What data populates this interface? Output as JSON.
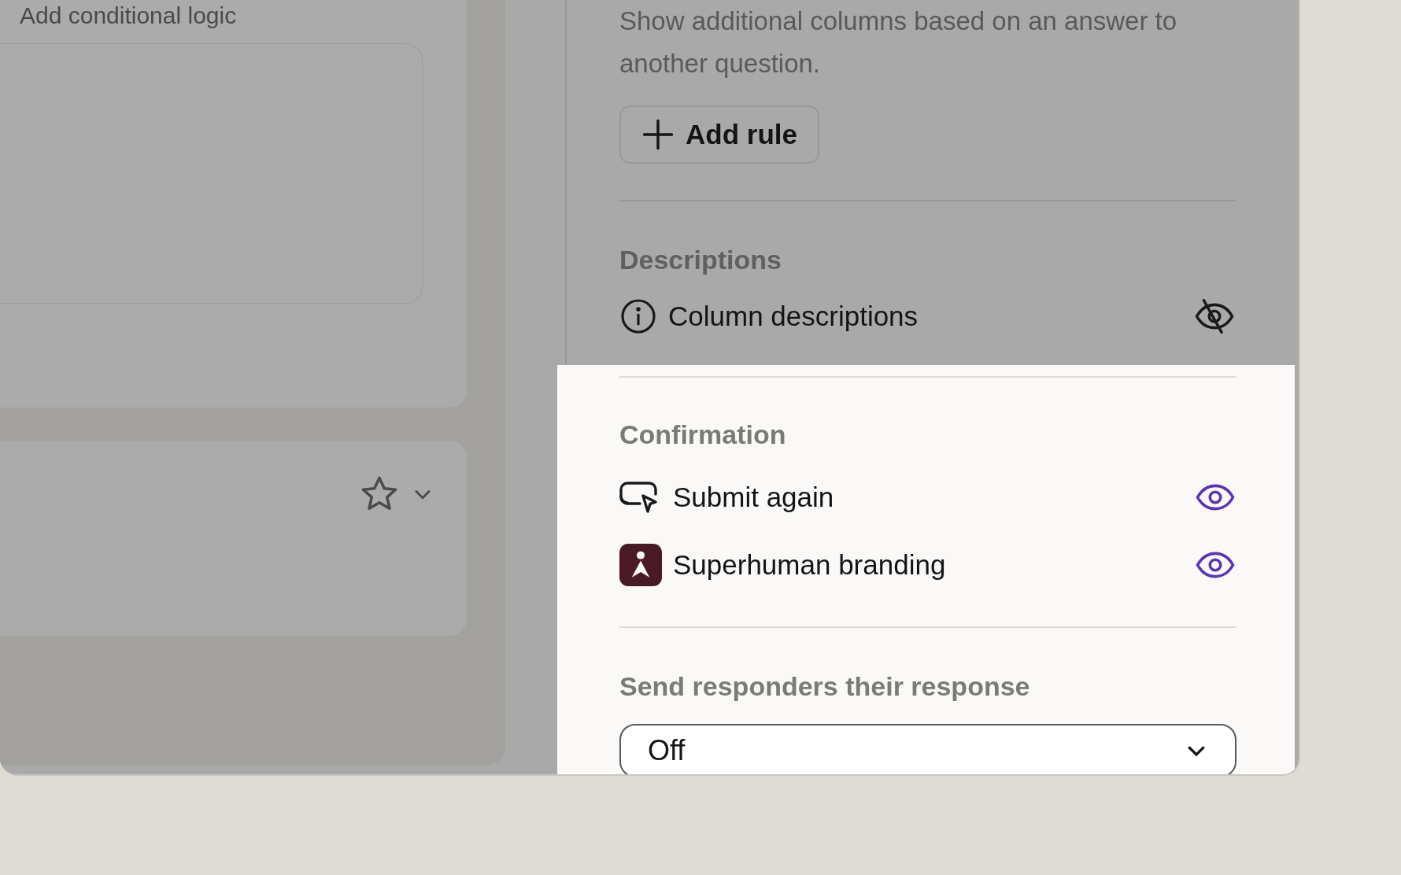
{
  "left_panel": {
    "heading": "Add conditional logic"
  },
  "description": "Show additional columns based on an answer to another question.",
  "add_rule_button": {
    "label": "Add rule"
  },
  "sections": [
    {
      "title": "Descriptions",
      "highlighted": false,
      "items": [
        {
          "kind": "info",
          "label": "Column descriptions",
          "visible": false
        }
      ]
    },
    {
      "title": "Confirmation",
      "highlighted": true,
      "items": [
        {
          "kind": "submit",
          "label": "Submit again",
          "visible": true
        },
        {
          "kind": "brand",
          "label": "Superhuman branding",
          "visible": true
        }
      ]
    }
  ],
  "response_section": {
    "title": "Send responders their response",
    "highlighted": true,
    "select": {
      "value": "Off"
    }
  }
}
